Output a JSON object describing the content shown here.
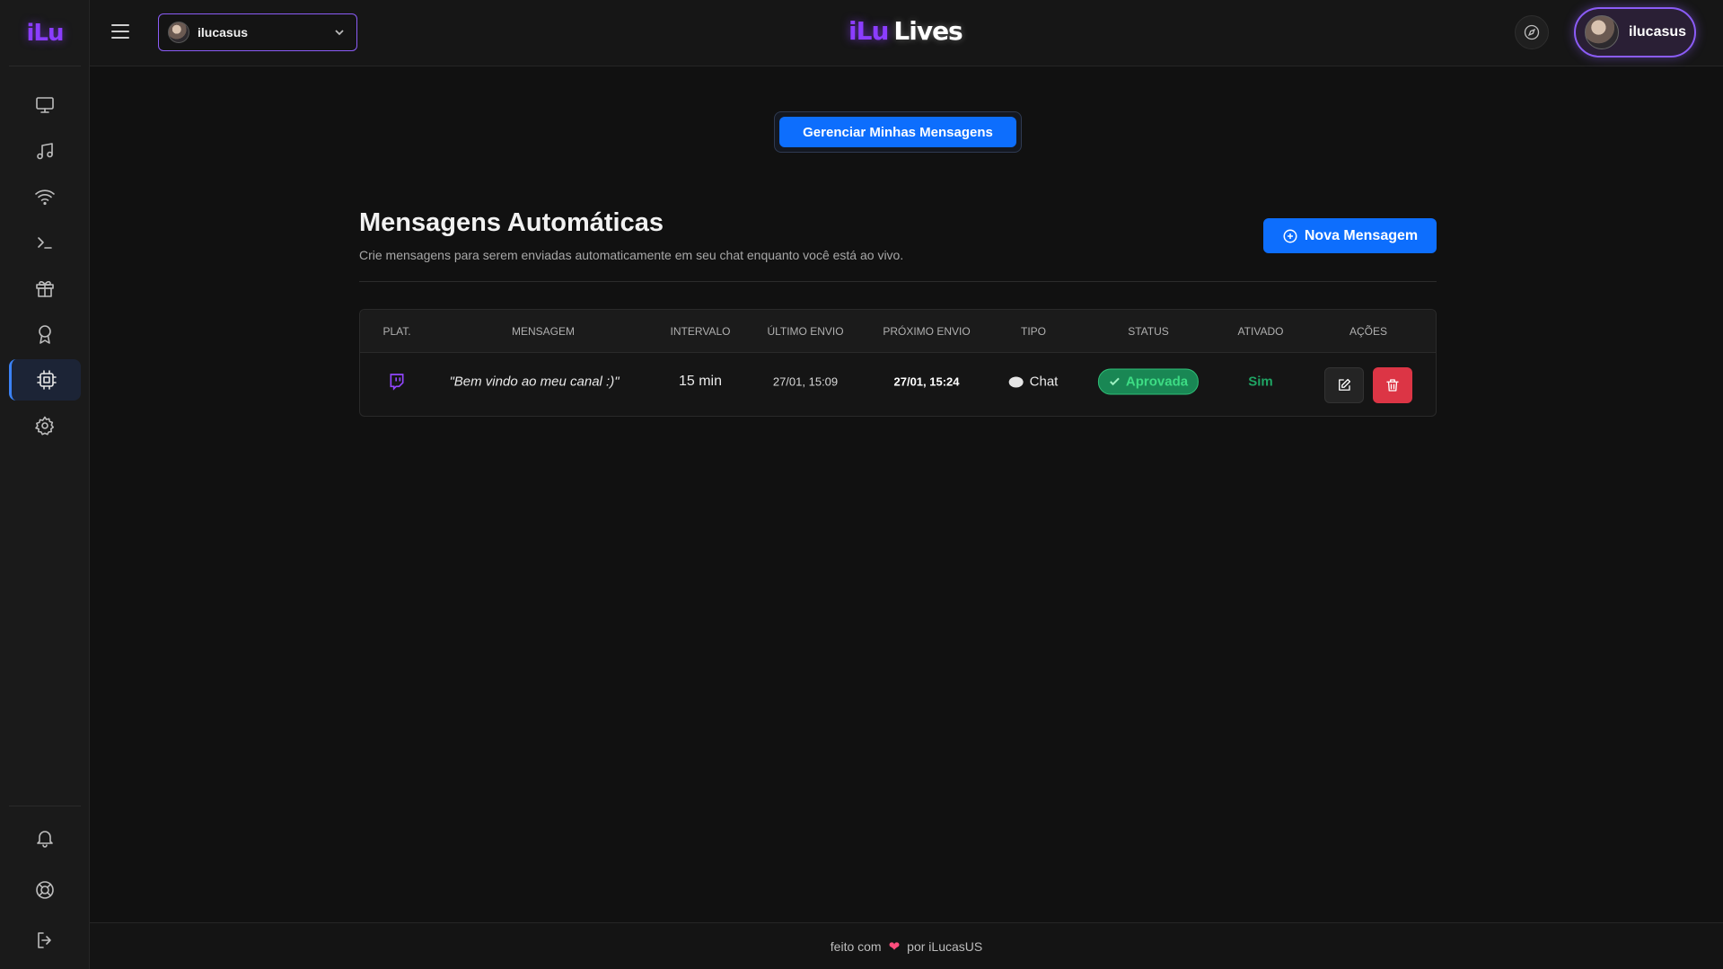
{
  "sidebar": {
    "logo": "iLu",
    "items": [
      {
        "icon": "monitor-icon"
      },
      {
        "icon": "music-icon"
      },
      {
        "icon": "wifi-icon"
      },
      {
        "icon": "terminal-icon"
      },
      {
        "icon": "gift-icon"
      },
      {
        "icon": "award-icon"
      },
      {
        "icon": "cpu-icon",
        "active": true
      },
      {
        "icon": "settings-icon"
      }
    ],
    "bottom_items": [
      {
        "icon": "bell-icon"
      },
      {
        "icon": "lifebuoy-icon"
      },
      {
        "icon": "logout-icon"
      }
    ]
  },
  "header": {
    "channel": "ilucasus",
    "brand_part1": "iLu",
    "brand_part2": "Lives",
    "user_name": "ilucasus"
  },
  "main": {
    "manage_button": "Gerenciar Minhas Mensagens",
    "title": "Mensagens Automáticas",
    "subtitle": "Crie mensagens para serem enviadas automaticamente em seu chat enquanto você está ao vivo.",
    "new_button": "Nova Mensagem",
    "table": {
      "headers": [
        "Plat.",
        "Mensagem",
        "Intervalo",
        "Último Envio",
        "Próximo Envio",
        "Tipo",
        "Status",
        "Ativado",
        "Ações"
      ],
      "rows": [
        {
          "platform": "twitch-icon",
          "message": "\"Bem vindo ao meu canal :)\"",
          "interval": "15 min",
          "last_sent": "27/01, 15:09",
          "next_send": "27/01, 15:24",
          "type": "Chat",
          "status": "Aprovada",
          "enabled": "Sim"
        }
      ]
    }
  },
  "footer": {
    "prefix": "feito com",
    "suffix": "por iLucasUS"
  },
  "colors": {
    "accent": "#0d6efd",
    "brand_purple": "#8b3dff",
    "success": "#198754",
    "danger": "#dc3545"
  }
}
